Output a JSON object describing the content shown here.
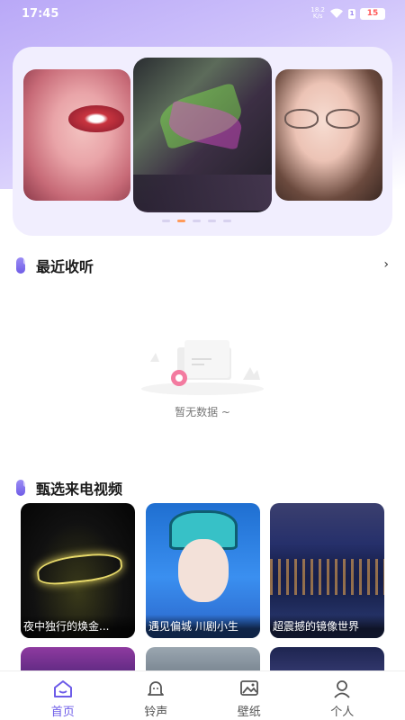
{
  "status_bar": {
    "time": "17:45",
    "net_speed_value": "18.2",
    "net_speed_unit": "K/s",
    "sim_badge": "1",
    "battery": "15"
  },
  "banner": {
    "dots_count": 5,
    "active_dot": 1
  },
  "recent": {
    "title": "最近收听",
    "more_icon": "chevron-right-icon",
    "empty_text": "暂无数据 ~"
  },
  "featured": {
    "title": "甄选来电视频",
    "videos": [
      {
        "title": "夜中独行的焕金..."
      },
      {
        "title": "遇见偏城 川剧小生"
      },
      {
        "title": "超震撼的镜像世界"
      }
    ]
  },
  "tabbar": {
    "tabs": [
      {
        "label": "首页",
        "icon": "home-icon",
        "active": true
      },
      {
        "label": "铃声",
        "icon": "bell-icon",
        "active": false
      },
      {
        "label": "壁纸",
        "icon": "image-icon",
        "active": false
      },
      {
        "label": "个人",
        "icon": "user-icon",
        "active": false
      }
    ]
  },
  "colors": {
    "accent": "#6d5ce8",
    "active_dot": "#ff9a5a",
    "header_gradient": "#b9a8f7"
  }
}
